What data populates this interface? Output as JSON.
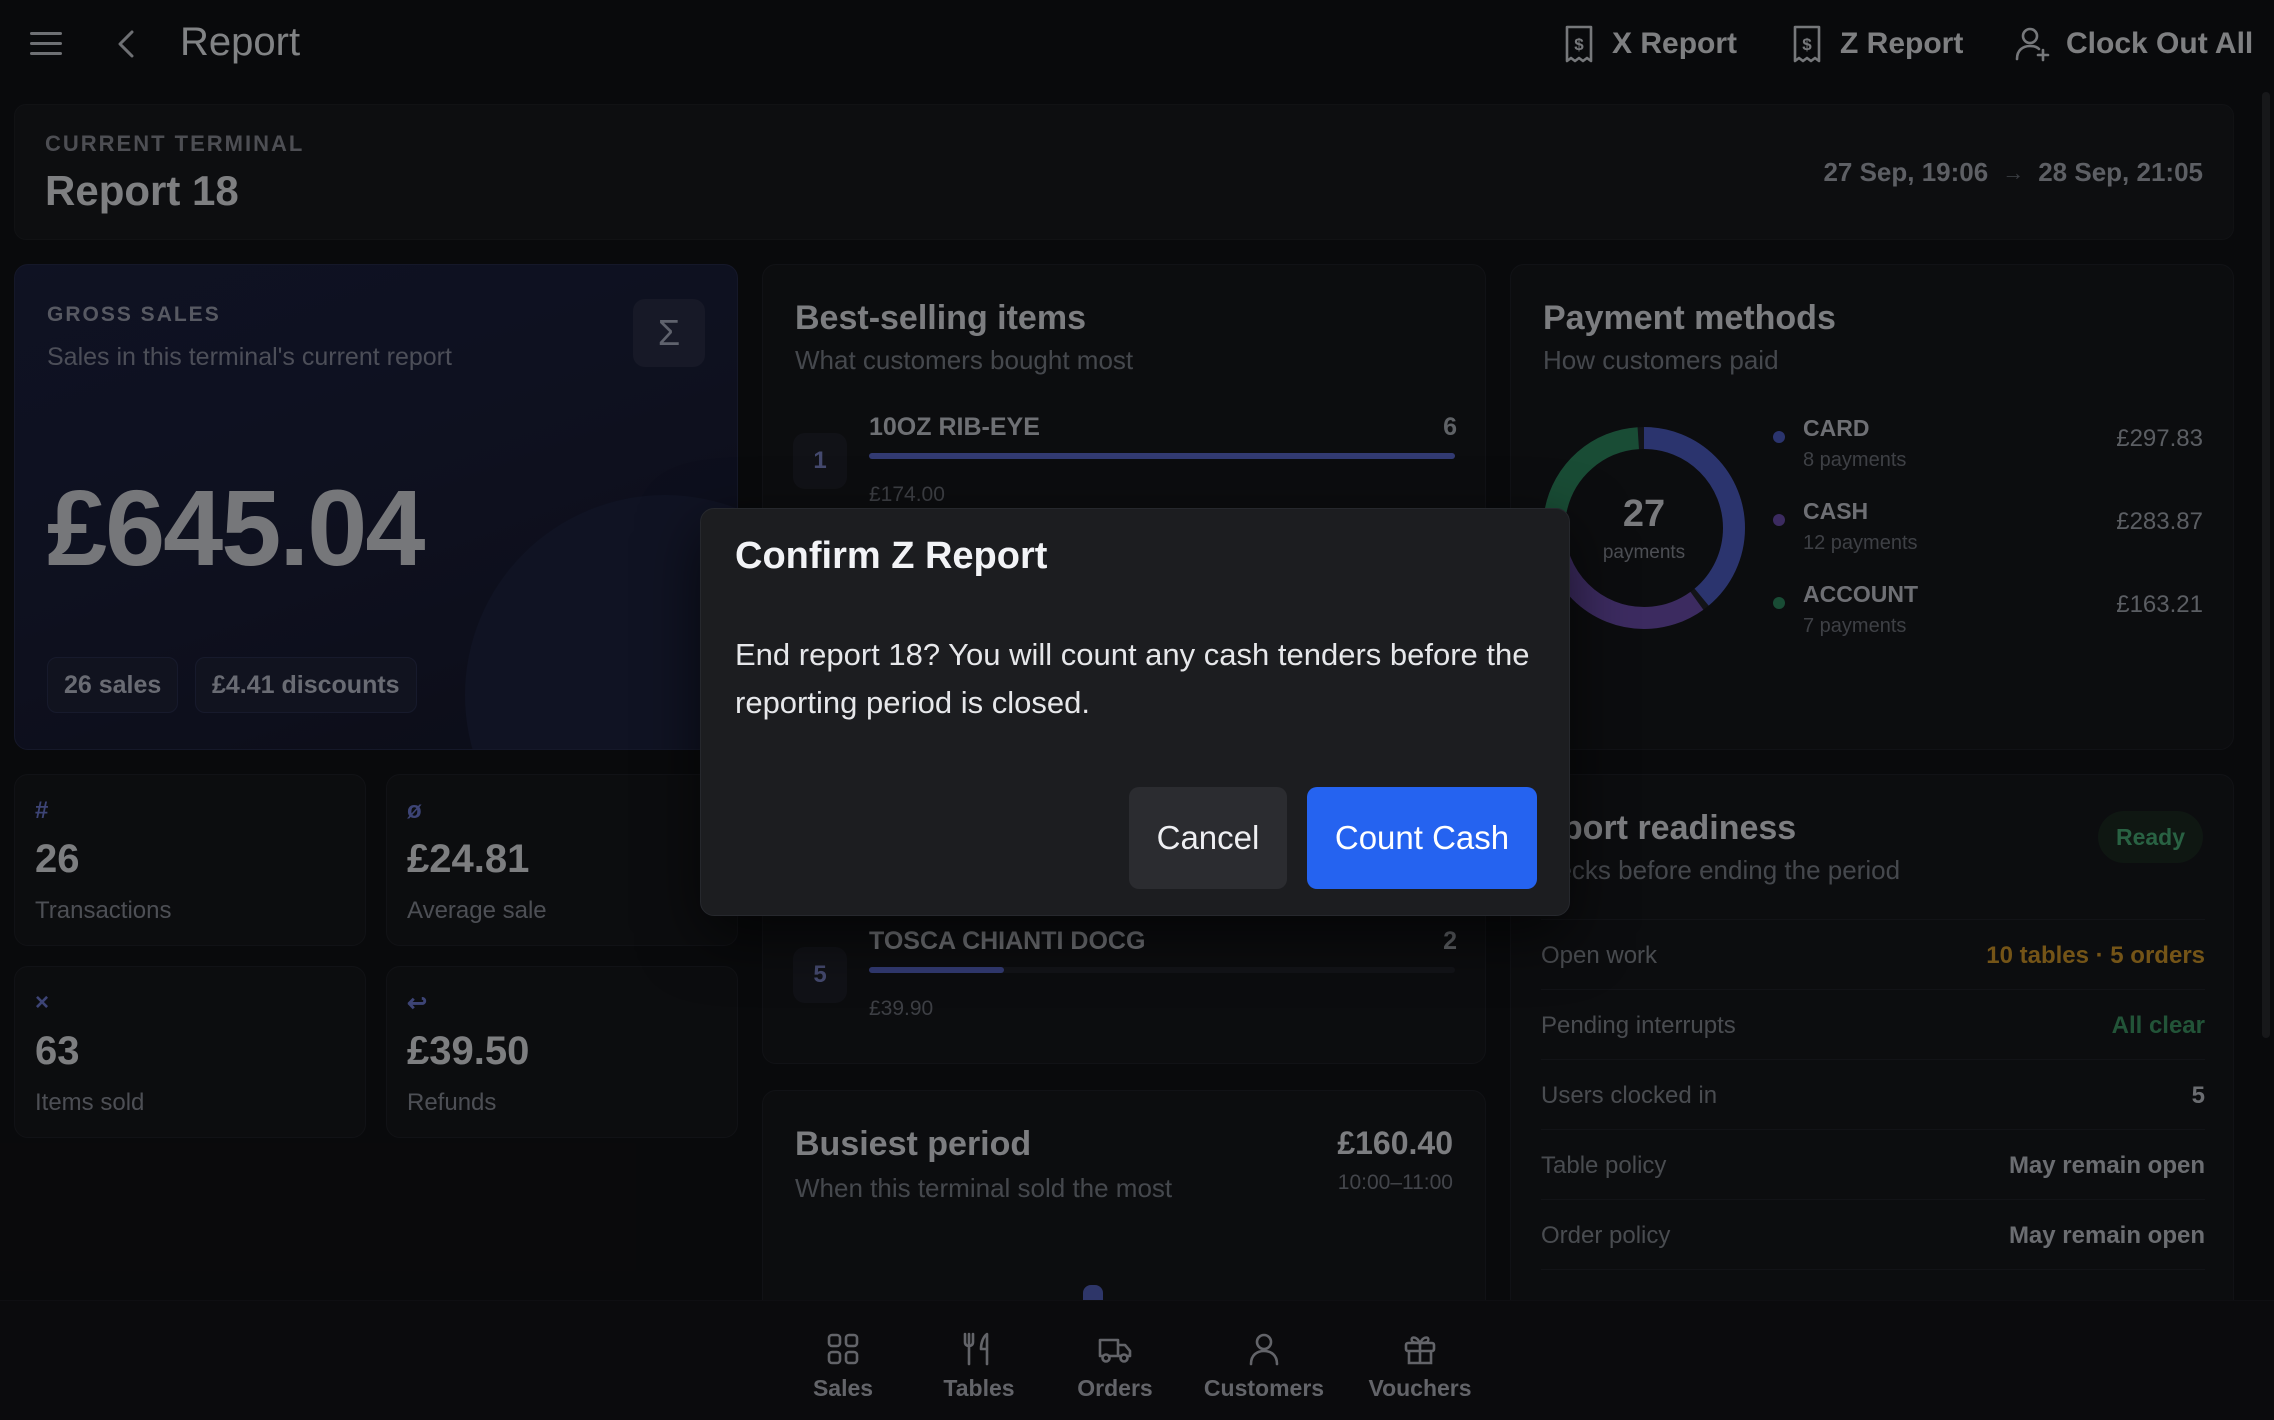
{
  "topbar": {
    "title": "Report",
    "actions": {
      "x_report": "X Report",
      "z_report": "Z Report",
      "clock_out": "Clock Out All"
    }
  },
  "terminal": {
    "label": "CURRENT TERMINAL",
    "name": "Report 18",
    "range_start": "27 Sep, 19:06",
    "range_arrow": "→",
    "range_end": "28 Sep, 21:05"
  },
  "gross": {
    "label": "GROSS SALES",
    "subtitle": "Sales in this terminal's current report",
    "sigma": "Σ",
    "amount": "£645.04",
    "sales_chip": "26 sales",
    "discounts_chip": "£4.41 discounts"
  },
  "stats": [
    {
      "icon": "#",
      "value": "26",
      "caption": "Transactions"
    },
    {
      "icon": "ø",
      "value": "£24.81",
      "caption": "Average sale"
    },
    {
      "icon": "×",
      "value": "63",
      "caption": "Items sold"
    },
    {
      "icon": "↩",
      "value": "£39.50",
      "caption": "Refunds"
    }
  ],
  "best_selling": {
    "title": "Best-selling items",
    "subtitle": "What customers bought most",
    "items": [
      {
        "rank": "1",
        "name": "10OZ RIB-EYE",
        "qty": "6",
        "price": "£174.00",
        "share": 1.0
      },
      {
        "rank": "5",
        "name": "TOSCA CHIANTI DOCG",
        "qty": "2",
        "price": "£39.90",
        "share": 0.23
      }
    ]
  },
  "busiest": {
    "title": "Busiest period",
    "subtitle": "When this terminal sold the most",
    "amount": "£160.40",
    "time": "10:00–11:00"
  },
  "payments": {
    "title": "Payment methods",
    "subtitle": "How customers paid",
    "total_count": "27",
    "total_unit": "payments",
    "methods": [
      {
        "name": "CARD",
        "count": "8 payments",
        "amount": "£297.83",
        "color": "#4f5fc9",
        "value": 297.83
      },
      {
        "name": "CASH",
        "count": "12 payments",
        "amount": "£283.87",
        "color": "#6d4fb0",
        "value": 283.87
      },
      {
        "name": "ACCOUNT",
        "count": "7 payments",
        "amount": "£163.21",
        "color": "#2f8a62",
        "value": 163.21
      }
    ]
  },
  "readiness": {
    "title": "eport readiness",
    "subtitle": "necks before ending the period",
    "badge": "Ready",
    "rows": [
      {
        "key": "Open work",
        "value": "10 tables · 5 orders",
        "color": "#d49a2a"
      },
      {
        "key": "Pending interrupts",
        "value": "All clear",
        "color": "#3f9a66"
      },
      {
        "key": "Users clocked in",
        "value": "5",
        "color": "#c4c7ce"
      },
      {
        "key": "Table policy",
        "value": "May remain open",
        "color": "#c4c7ce"
      },
      {
        "key": "Order policy",
        "value": "May remain open",
        "color": "#c4c7ce"
      }
    ]
  },
  "bottom_nav": {
    "sales": "Sales",
    "tables": "Tables",
    "orders": "Orders",
    "customers": "Customers",
    "vouchers": "Vouchers"
  },
  "dialog": {
    "title": "Confirm Z Report",
    "body": "End report 18? You will count any cash tenders before the reporting period is closed.",
    "cancel": "Cancel",
    "confirm": "Count Cash"
  },
  "colors": {
    "accent": "#2563f0",
    "bar": "#5c6ad0"
  }
}
